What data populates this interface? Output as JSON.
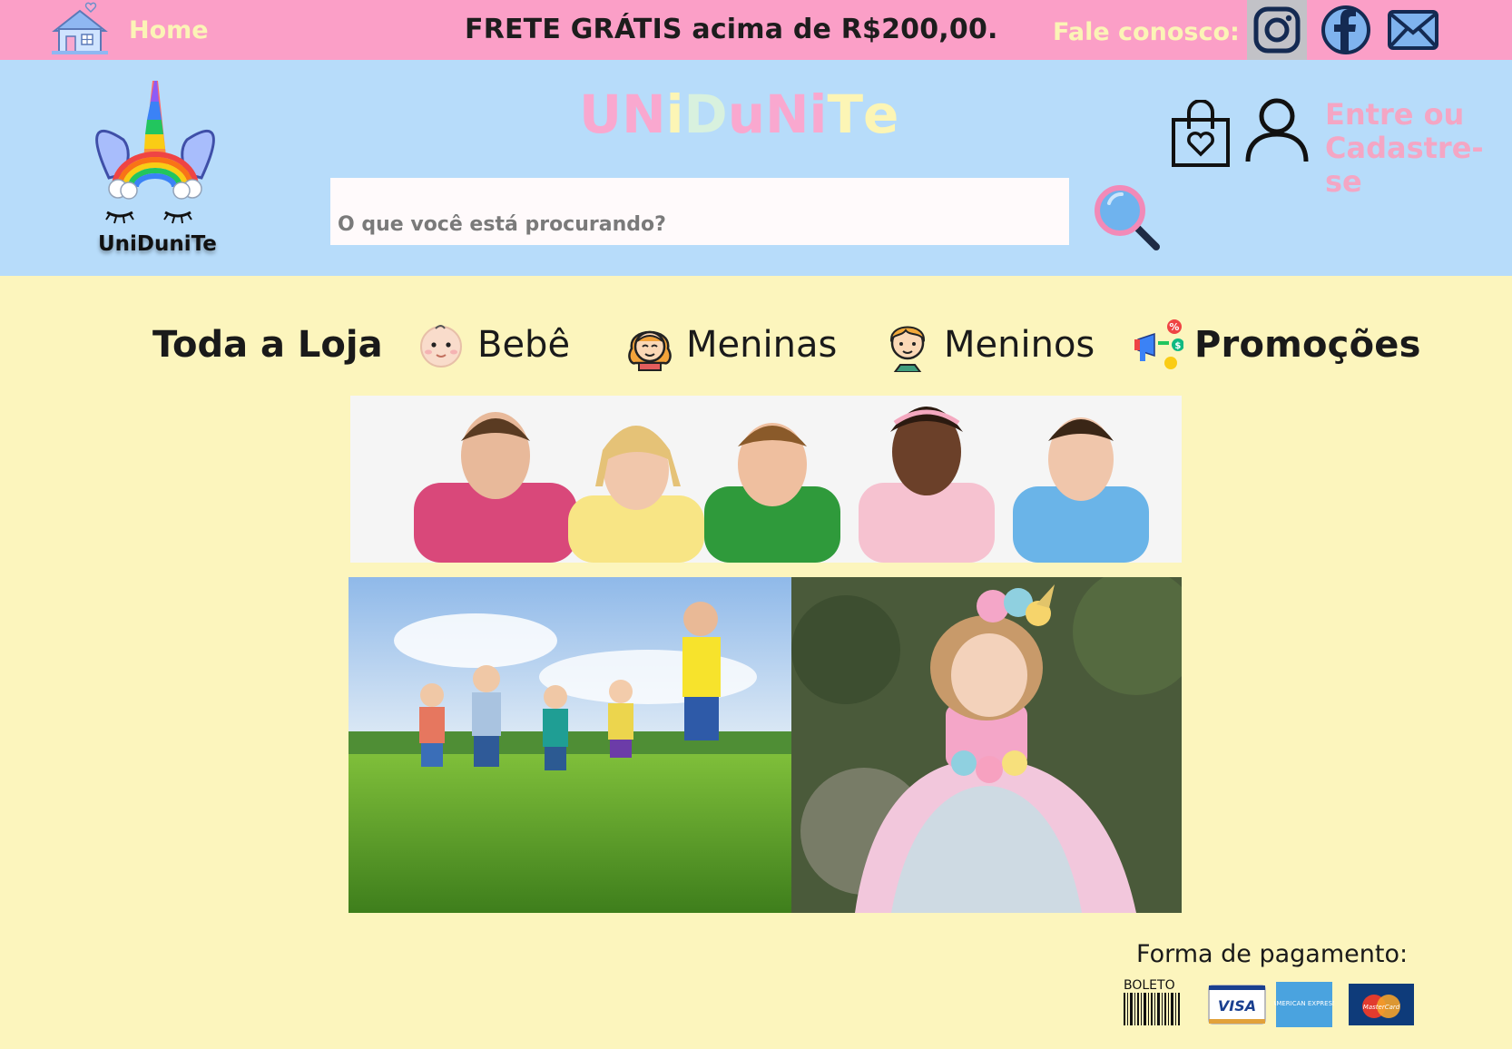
{
  "topbar": {
    "home_label": "Home",
    "promo_text": "FRETE GRÁTIS acima de R$200,00.",
    "contact_label": "Fale conosco:",
    "social": [
      "instagram-icon",
      "facebook-icon",
      "mail-icon"
    ]
  },
  "header": {
    "logo_text": "UniDuniTe",
    "brand_letters": [
      {
        "ch": "U",
        "color": "#f9a8cf"
      },
      {
        "ch": "N",
        "color": "#f9a8cf"
      },
      {
        "ch": "i",
        "color": "#fcf5b5"
      },
      {
        "ch": "D",
        "color": "#d8f1de"
      },
      {
        "ch": "u",
        "color": "#f9a8cf"
      },
      {
        "ch": "N",
        "color": "#f9a8cf"
      },
      {
        "ch": "i",
        "color": "#f9a8cf"
      },
      {
        "ch": "T",
        "color": "#fcf5b5"
      },
      {
        "ch": "e",
        "color": "#fcf5b5"
      }
    ],
    "search_placeholder": "O que você está procurando?",
    "login_line1": "Entre ou",
    "login_line2": "Cadastre-se"
  },
  "nav": {
    "all": "Toda a Loja",
    "bebe": "Bebê",
    "meninas": "Meninas",
    "meninos": "Meninos",
    "promocoes": "Promoções"
  },
  "footer": {
    "payment_label": "Forma de pagamento:",
    "boleto_label": "BOLETO",
    "visa_label": "VISA",
    "amex_label": "AMERICAN EXPRESS",
    "mastercard_label": "MasterCard"
  },
  "colors": {
    "topbar": "#fb9fc7",
    "header": "#b7dcfa",
    "page": "#fcf5bd"
  }
}
